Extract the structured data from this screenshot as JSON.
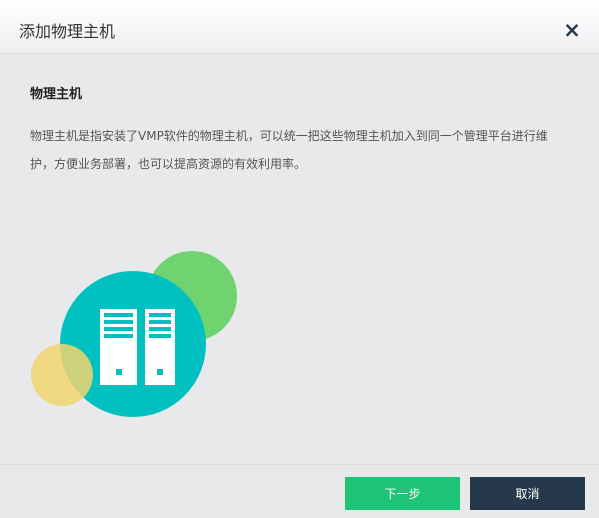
{
  "dialog": {
    "title": "添加物理主机",
    "close_symbol": "×"
  },
  "content": {
    "section_title": "物理主机",
    "description_line1": "物理主机是指安装了VMP软件的物理主机，可以统一把这些物理主机加入到同一个管理平台进行维",
    "description_line2": "护，方便业务部署，也可以提高资源的有效利用率。"
  },
  "illustration": {
    "icon": "server-rack-icon",
    "colors": {
      "teal": "#00c1c0",
      "green": "#64d064",
      "yellow": "#f1d36e",
      "white": "#ffffff"
    }
  },
  "footer": {
    "next_label": "下一步",
    "cancel_label": "取消",
    "next_color": "#1ec476",
    "cancel_color": "#26394a"
  }
}
